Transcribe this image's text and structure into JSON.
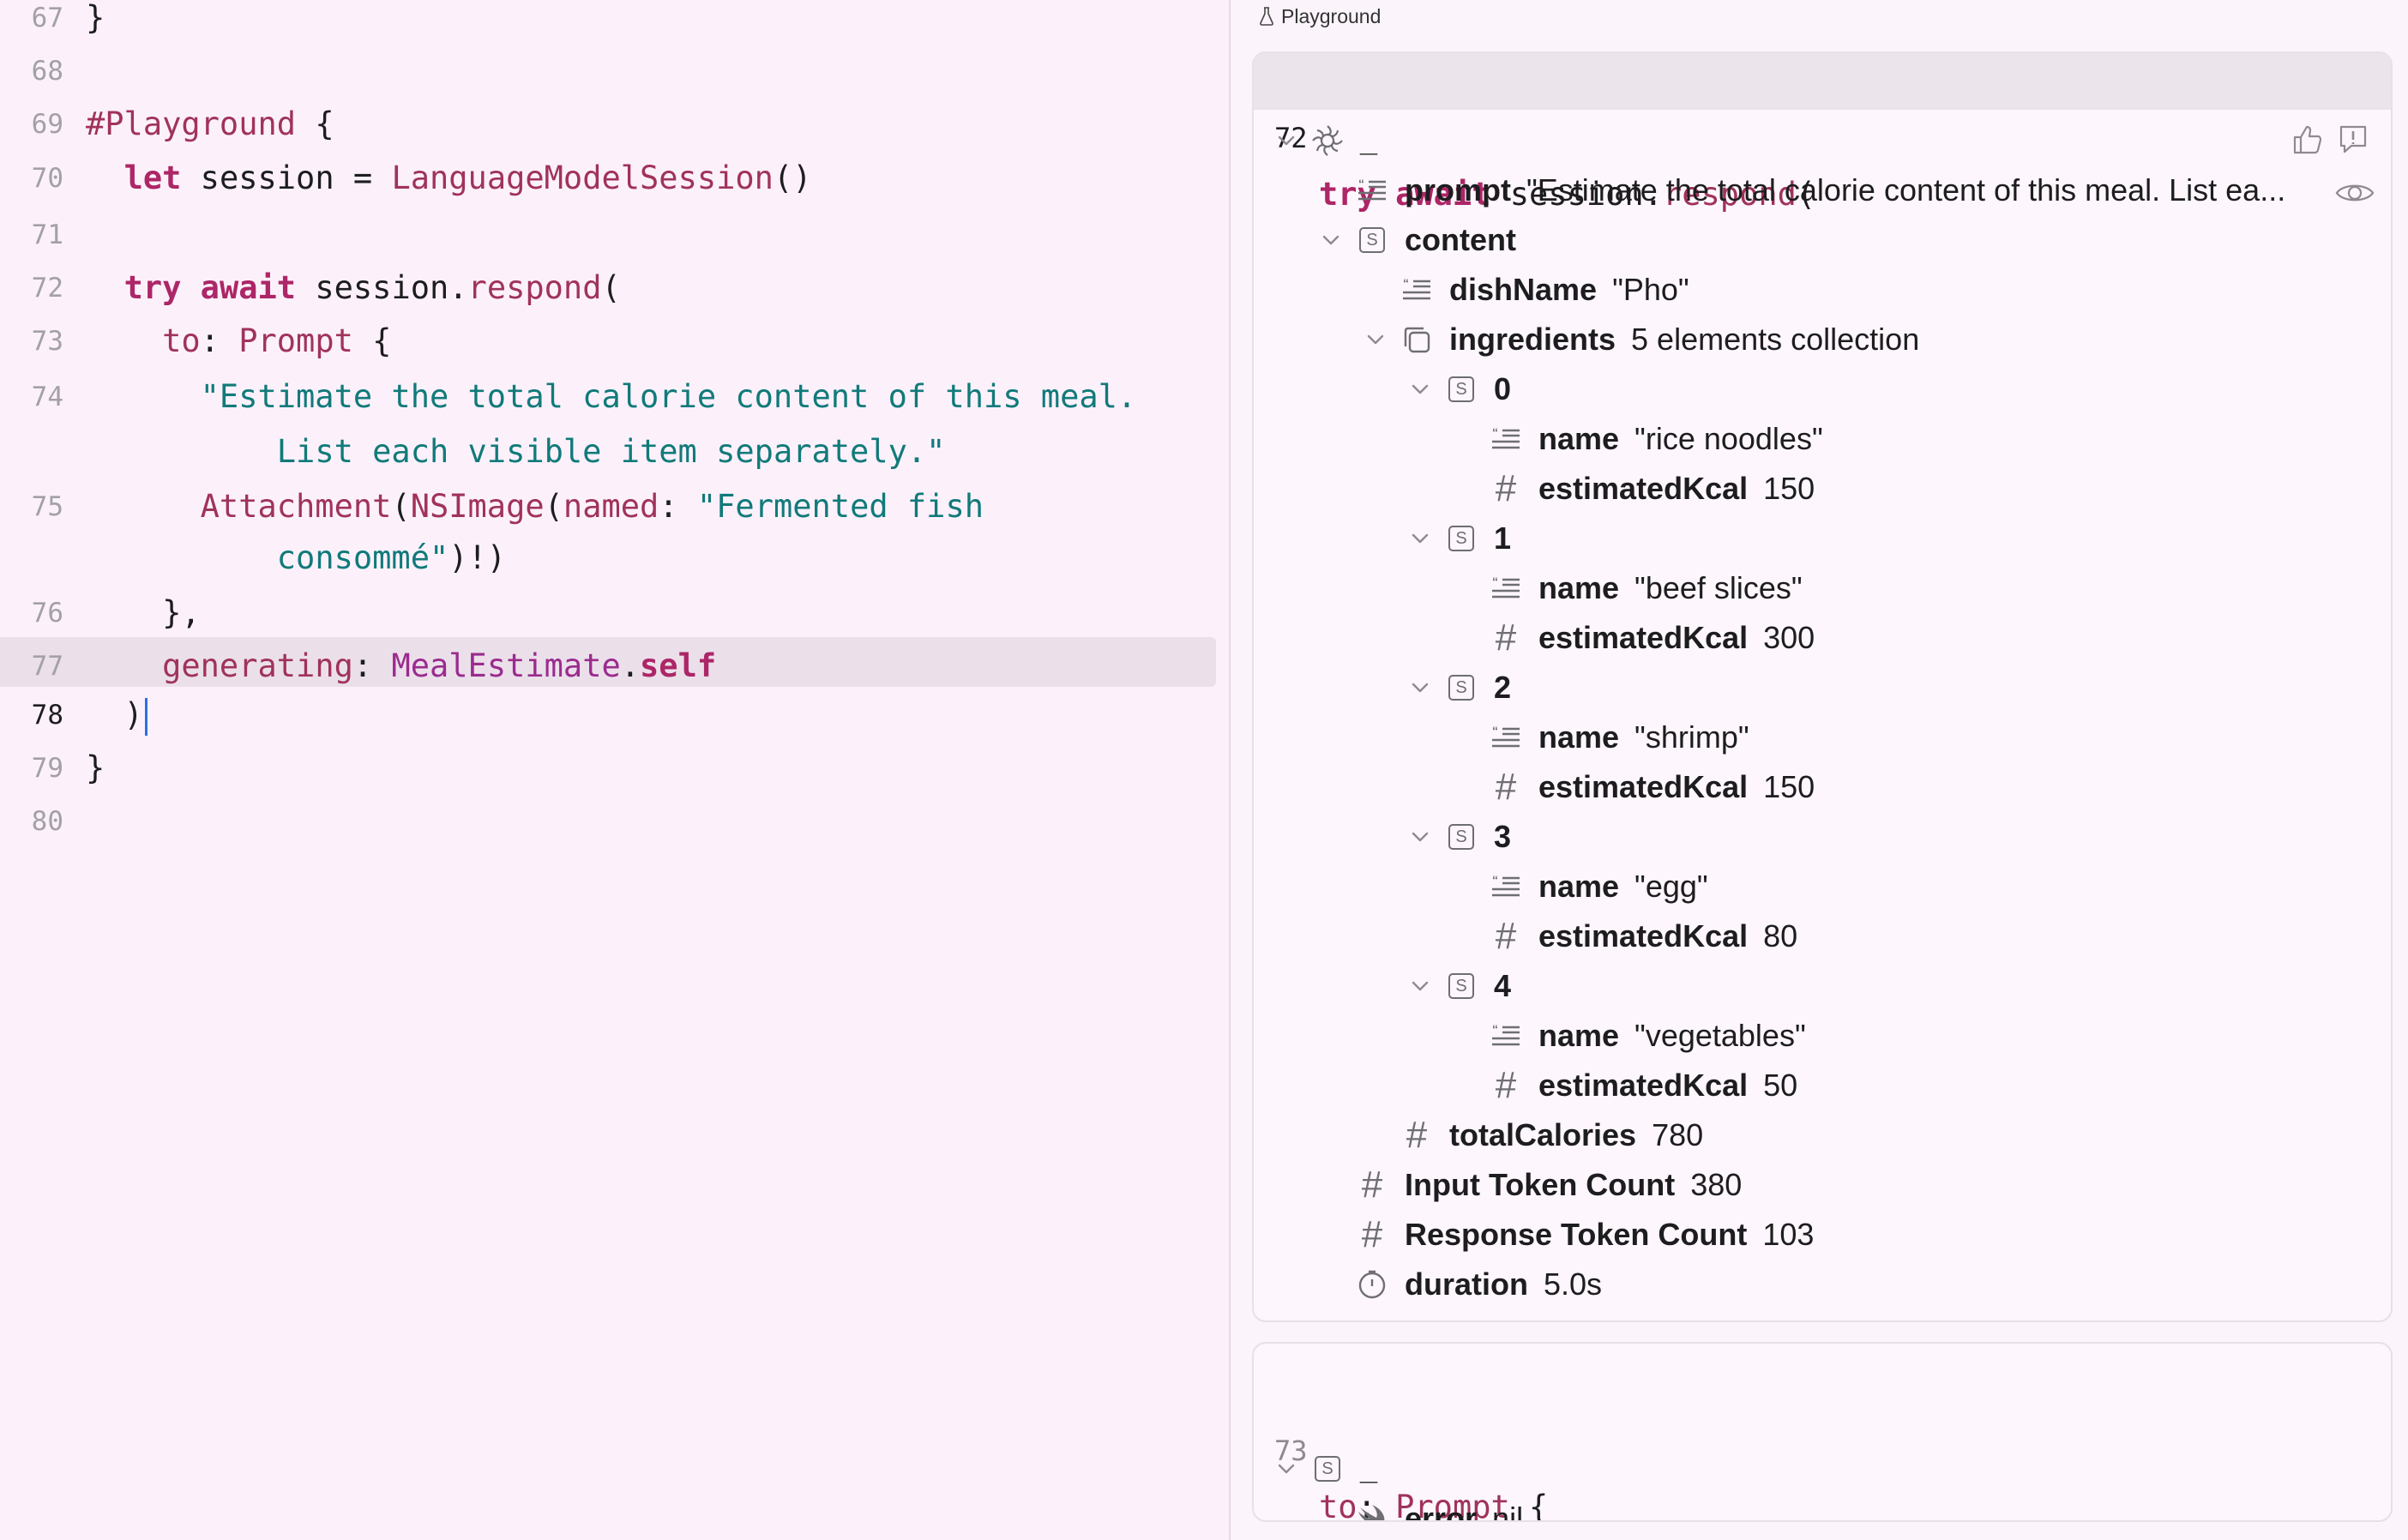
{
  "editor": {
    "lines": [
      {
        "num": "67",
        "tokens": [
          {
            "t": "}",
            "c": "pl"
          }
        ]
      },
      {
        "num": "68",
        "tokens": []
      },
      {
        "num": "69",
        "tokens": [
          {
            "t": "#Playground",
            "c": "fn"
          },
          {
            "t": " {",
            "c": "pl"
          }
        ]
      },
      {
        "num": "70",
        "tokens": [
          {
            "t": "  ",
            "c": "pl"
          },
          {
            "t": "let",
            "c": "kw"
          },
          {
            "t": " session = ",
            "c": "pl"
          },
          {
            "t": "LanguageModelSession",
            "c": "fn"
          },
          {
            "t": "()",
            "c": "pl"
          }
        ]
      },
      {
        "num": "71",
        "tokens": []
      },
      {
        "num": "72",
        "tokens": [
          {
            "t": "  ",
            "c": "pl"
          },
          {
            "t": "try",
            "c": "kw"
          },
          {
            "t": " ",
            "c": "pl"
          },
          {
            "t": "await",
            "c": "kw"
          },
          {
            "t": " session.",
            "c": "pl"
          },
          {
            "t": "respond",
            "c": "fn"
          },
          {
            "t": "(",
            "c": "pl"
          }
        ]
      },
      {
        "num": "73",
        "tokens": [
          {
            "t": "    ",
            "c": "pl"
          },
          {
            "t": "to",
            "c": "fn"
          },
          {
            "t": ": ",
            "c": "pl"
          },
          {
            "t": "Prompt",
            "c": "fn"
          },
          {
            "t": " {",
            "c": "pl"
          }
        ]
      },
      {
        "num": "74",
        "tokens": [
          {
            "t": "      ",
            "c": "pl"
          },
          {
            "t": "\"Estimate the total calorie content of this meal.",
            "c": "str"
          }
        ]
      },
      {
        "num": "",
        "tokens": [
          {
            "t": "          ",
            "c": "pl"
          },
          {
            "t": "List each visible item separately.\"",
            "c": "str"
          }
        ]
      },
      {
        "num": "75",
        "tokens": [
          {
            "t": "      ",
            "c": "pl"
          },
          {
            "t": "Attachment",
            "c": "fn"
          },
          {
            "t": "(",
            "c": "pl"
          },
          {
            "t": "NSImage",
            "c": "fn"
          },
          {
            "t": "(",
            "c": "pl"
          },
          {
            "t": "named",
            "c": "fn"
          },
          {
            "t": ": ",
            "c": "pl"
          },
          {
            "t": "\"Fermented fish",
            "c": "str"
          }
        ]
      },
      {
        "num": "",
        "tokens": [
          {
            "t": "          ",
            "c": "pl"
          },
          {
            "t": "consommé\"",
            "c": "str"
          },
          {
            "t": ")!)",
            "c": "pl"
          }
        ]
      },
      {
        "num": "76",
        "tokens": [
          {
            "t": "    },",
            "c": "pl"
          }
        ]
      },
      {
        "num": "77",
        "tokens": [
          {
            "t": "    ",
            "c": "pl"
          },
          {
            "t": "generating",
            "c": "fn"
          },
          {
            "t": ": ",
            "c": "pl"
          },
          {
            "t": "MealEstimate",
            "c": "ty"
          },
          {
            "t": ".",
            "c": "pl"
          },
          {
            "t": "self",
            "c": "kw"
          }
        ]
      },
      {
        "num": "78",
        "tokens": [
          {
            "t": "  )",
            "c": "pl"
          }
        ],
        "current": true
      },
      {
        "num": "79",
        "tokens": [
          {
            "t": "}",
            "c": "pl"
          }
        ]
      },
      {
        "num": "80",
        "tokens": []
      }
    ]
  },
  "canvas": {
    "title": "Playground",
    "card1": {
      "line_num": "72",
      "code": [
        {
          "t": "try",
          "c": "kw"
        },
        {
          "t": " ",
          "c": "pl"
        },
        {
          "t": "await",
          "c": "kw"
        },
        {
          "t": " session.",
          "c": "pl"
        },
        {
          "t": "respond",
          "c": "fn"
        },
        {
          "t": "(",
          "c": "pl"
        }
      ],
      "rows": [
        {
          "depth": 0,
          "chevron": true,
          "icon": "model",
          "label": "_",
          "value": ""
        },
        {
          "depth": 1,
          "chevron": false,
          "icon": "string",
          "label": "prompt",
          "value": "\"Estimate the total calorie content of this meal. List ea..."
        },
        {
          "depth": 1,
          "chevron": true,
          "icon": "struct",
          "label": "content",
          "value": ""
        },
        {
          "depth": 2,
          "chevron": false,
          "icon": "string",
          "label": "dishName",
          "value": "\"Pho\""
        },
        {
          "depth": 2,
          "chevron": true,
          "icon": "collection",
          "label": "ingredients",
          "value": "5 elements collection"
        },
        {
          "depth": 3,
          "chevron": true,
          "icon": "struct",
          "label": "0",
          "value": ""
        },
        {
          "depth": 4,
          "chevron": false,
          "icon": "string",
          "label": "name",
          "value": "\"rice noodles\""
        },
        {
          "depth": 4,
          "chevron": false,
          "icon": "number",
          "label": "estimatedKcal",
          "value": "150"
        },
        {
          "depth": 3,
          "chevron": true,
          "icon": "struct",
          "label": "1",
          "value": ""
        },
        {
          "depth": 4,
          "chevron": false,
          "icon": "string",
          "label": "name",
          "value": "\"beef slices\""
        },
        {
          "depth": 4,
          "chevron": false,
          "icon": "number",
          "label": "estimatedKcal",
          "value": "300"
        },
        {
          "depth": 3,
          "chevron": true,
          "icon": "struct",
          "label": "2",
          "value": ""
        },
        {
          "depth": 4,
          "chevron": false,
          "icon": "string",
          "label": "name",
          "value": "\"shrimp\""
        },
        {
          "depth": 4,
          "chevron": false,
          "icon": "number",
          "label": "estimatedKcal",
          "value": "150"
        },
        {
          "depth": 3,
          "chevron": true,
          "icon": "struct",
          "label": "3",
          "value": ""
        },
        {
          "depth": 4,
          "chevron": false,
          "icon": "string",
          "label": "name",
          "value": "\"egg\""
        },
        {
          "depth": 4,
          "chevron": false,
          "icon": "number",
          "label": "estimatedKcal",
          "value": "80"
        },
        {
          "depth": 3,
          "chevron": true,
          "icon": "struct",
          "label": "4",
          "value": ""
        },
        {
          "depth": 4,
          "chevron": false,
          "icon": "string",
          "label": "name",
          "value": "\"vegetables\""
        },
        {
          "depth": 4,
          "chevron": false,
          "icon": "number",
          "label": "estimatedKcal",
          "value": "50"
        },
        {
          "depth": 2,
          "chevron": false,
          "icon": "number",
          "label": "totalCalories",
          "value": "780"
        },
        {
          "depth": 1,
          "chevron": false,
          "icon": "number",
          "label": "Input Token Count",
          "value": "380"
        },
        {
          "depth": 1,
          "chevron": false,
          "icon": "number",
          "label": "Response Token Count",
          "value": "103"
        },
        {
          "depth": 1,
          "chevron": false,
          "icon": "timer",
          "label": "duration",
          "value": "5.0s"
        }
      ]
    },
    "card2": {
      "line_num": "73",
      "code": [
        {
          "t": "to",
          "c": "fn"
        },
        {
          "t": ": ",
          "c": "pl"
        },
        {
          "t": "Prompt",
          "c": "fn"
        },
        {
          "t": " {",
          "c": "pl"
        }
      ],
      "rows": [
        {
          "depth": 0,
          "chevron": true,
          "icon": "struct",
          "label": "_",
          "value": ""
        },
        {
          "depth": 1,
          "chevron": false,
          "icon": "swift",
          "label": "error",
          "value": "nil"
        }
      ]
    }
  },
  "colors": {
    "keyword": "#ad2667",
    "string": "#117a7a",
    "function": "#a0335a",
    "type": "#9b2b8f"
  }
}
